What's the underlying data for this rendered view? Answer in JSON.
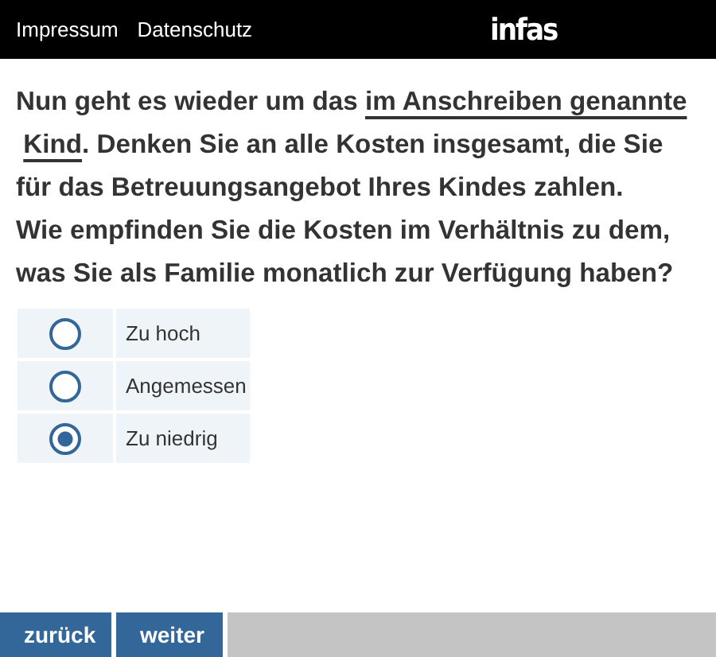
{
  "header": {
    "links": [
      "Impressum",
      "Datenschutz"
    ],
    "logo": "infas"
  },
  "intro": [
    {
      "kind": "text",
      "text": "Nun geht es wieder um das "
    },
    {
      "kind": "term",
      "text": "im Anschreiben genannte"
    },
    {
      "kind": "term",
      "text": "Kind"
    },
    {
      "kind": "text",
      "text": ". Denken Sie an alle Kosten insgesamt, die Sie für das Betreuungsangebot Ihres Kindes zahlen."
    }
  ],
  "question": "Wie empfinden Sie die Kosten im Verhältnis zu dem, was Sie als Familie monatlich zur Verfügung haben?",
  "options": [
    {
      "label": "Zu hoch",
      "selected": false
    },
    {
      "label": "Angemessen",
      "selected": false
    },
    {
      "label": "Zu niedrig",
      "selected": true
    }
  ],
  "buttons": [
    "zurück",
    "weiter"
  ]
}
